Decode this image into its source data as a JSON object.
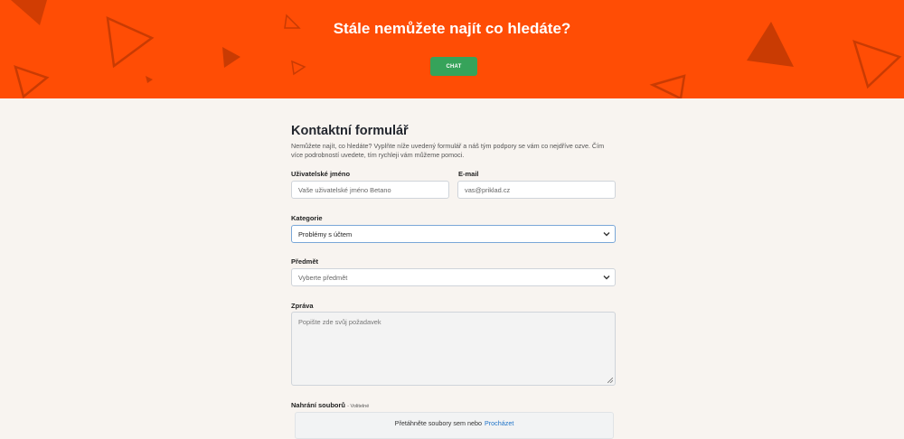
{
  "hero": {
    "title": "Stále nemůžete najít co hledáte?",
    "chat_button": "CHAT",
    "background_color": "#ff4d05",
    "accent_button_color": "#36a35a"
  },
  "form": {
    "title": "Kontaktní formulář",
    "intro": "Nemůžete najít, co hledáte? Vyplňte níže uvedený formulář a náš tým podpory se vám co nejdříve ozve. Čím více podrobností uvedete, tím rychleji vám můžeme pomoci.",
    "username": {
      "label": "Uživatelské jméno",
      "placeholder": "Vaše uživatelské jméno Betano"
    },
    "email": {
      "label": "E-mail",
      "placeholder": "vas@priklad.cz"
    },
    "category": {
      "label": "Kategorie",
      "value": "Problémy s účtem"
    },
    "subject": {
      "label": "Předmět",
      "value": "Vyberte předmět"
    },
    "message": {
      "label": "Zpráva",
      "placeholder": "Popište zde svůj požadavek"
    },
    "upload": {
      "label": "Nahrání souborů",
      "optional": "- Volitelné",
      "text": "Přetáhněte soubory sem nebo",
      "link": "Procházet"
    }
  },
  "icons": [
    "chevron-down-icon",
    "resize-handle-icon",
    "triangle-decoration-icon"
  ]
}
